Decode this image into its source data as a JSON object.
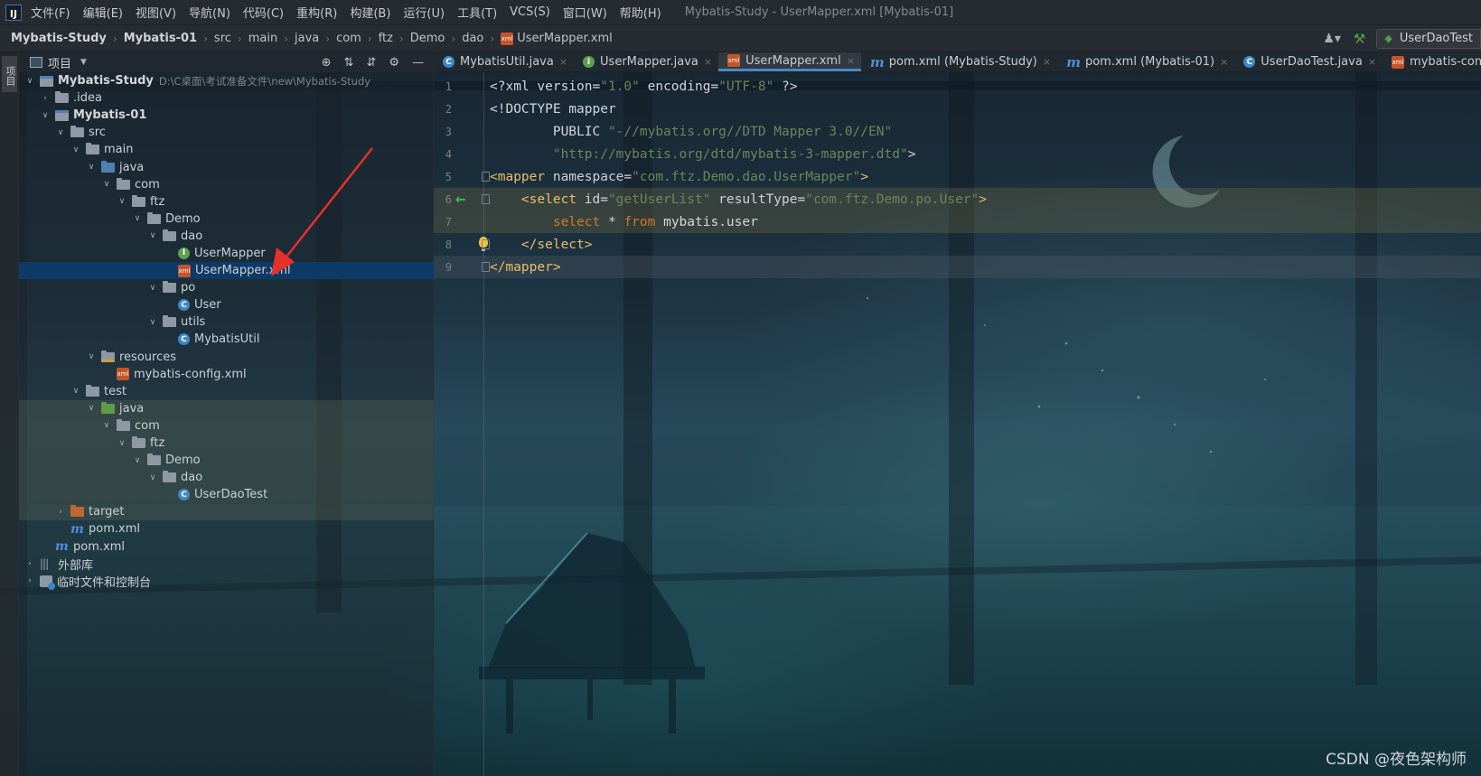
{
  "menubar": {
    "items": [
      "文件(F)",
      "编辑(E)",
      "视图(V)",
      "导航(N)",
      "代码(C)",
      "重构(R)",
      "构建(B)",
      "运行(U)",
      "工具(T)",
      "VCS(S)",
      "窗口(W)",
      "帮助(H)"
    ],
    "window_title": "Mybatis-Study - UserMapper.xml [Mybatis-01]"
  },
  "breadcrumb": {
    "items": [
      "Mybatis-Study",
      "Mybatis-01",
      "src",
      "main",
      "java",
      "com",
      "ftz",
      "Demo",
      "dao"
    ],
    "file": "UserMapper.xml"
  },
  "toolbar": {
    "run_config_label": "UserDaoTest"
  },
  "tool_strip": {
    "project_tab": "项目"
  },
  "project_panel": {
    "title": "项目",
    "tree": [
      {
        "label": "Mybatis-Study",
        "path": "D:\\C桌面\\考试准备文件\\new\\Mybatis-Study",
        "bold": true
      },
      {
        "label": ".idea"
      },
      {
        "label": "Mybatis-01",
        "bold": true
      },
      {
        "label": "src"
      },
      {
        "label": "main"
      },
      {
        "label": "java"
      },
      {
        "label": "com"
      },
      {
        "label": "ftz"
      },
      {
        "label": "Demo"
      },
      {
        "label": "dao"
      },
      {
        "label": "UserMapper"
      },
      {
        "label": "UserMapper.xml"
      },
      {
        "label": "po"
      },
      {
        "label": "User"
      },
      {
        "label": "utils"
      },
      {
        "label": "MybatisUtil"
      },
      {
        "label": "resources"
      },
      {
        "label": "mybatis-config.xml"
      },
      {
        "label": "test"
      },
      {
        "label": "java"
      },
      {
        "label": "com"
      },
      {
        "label": "ftz"
      },
      {
        "label": "Demo"
      },
      {
        "label": "dao"
      },
      {
        "label": "UserDaoTest"
      },
      {
        "label": "target"
      },
      {
        "label": "pom.xml"
      },
      {
        "label": "pom.xml"
      },
      {
        "label": "外部库"
      },
      {
        "label": "临时文件和控制台"
      }
    ]
  },
  "editor": {
    "tabs": [
      {
        "label": "MybatisUtil.java"
      },
      {
        "label": "UserMapper.java"
      },
      {
        "label": "UserMapper.xml"
      },
      {
        "label": "pom.xml (Mybatis-Study)"
      },
      {
        "label": "pom.xml (Mybatis-01)"
      },
      {
        "label": "UserDaoTest.java"
      },
      {
        "label": "mybatis-config.xml"
      }
    ],
    "active_tab": "UserMapper.xml",
    "lines": [
      {
        "no": "1",
        "tokens": [
          [
            "t-plain",
            "<?xml version="
          ],
          [
            "t-str",
            "\"1.0\""
          ],
          [
            "t-plain",
            " encoding="
          ],
          [
            "t-str",
            "\"UTF-8\""
          ],
          [
            "t-plain",
            " ?>"
          ]
        ]
      },
      {
        "no": "2",
        "tokens": [
          [
            "t-plain",
            "<!DOCTYPE mapper"
          ]
        ]
      },
      {
        "no": "3",
        "tokens": [
          [
            "t-plain",
            "        PUBLIC "
          ],
          [
            "t-str",
            "\"-//mybatis.org//DTD Mapper 3.0//EN\""
          ]
        ]
      },
      {
        "no": "4",
        "tokens": [
          [
            "t-plain",
            "        "
          ],
          [
            "t-str",
            "\"http://mybatis.org/dtd/mybatis-3-mapper.dtd\""
          ],
          [
            "t-plain",
            ">"
          ]
        ]
      },
      {
        "no": "5",
        "tokens": [
          [
            "t-tag",
            "<mapper"
          ],
          [
            "t-attr",
            " namespace="
          ],
          [
            "t-str",
            "\"com.ftz.Demo.dao.UserMapper\""
          ],
          [
            "t-tag",
            ">"
          ]
        ]
      },
      {
        "no": "6",
        "tokens": [
          [
            "t-tag",
            "    <select"
          ],
          [
            "t-attr",
            " id="
          ],
          [
            "t-str",
            "\"getUserList\""
          ],
          [
            "t-attr",
            " resultType="
          ],
          [
            "t-str",
            "\"com.ftz.Demo.po.User\""
          ],
          [
            "t-tag",
            ">"
          ]
        ]
      },
      {
        "no": "7",
        "tokens": [
          [
            "t-plain",
            "        "
          ],
          [
            "t-kw",
            "select"
          ],
          [
            "t-plain",
            " * "
          ],
          [
            "t-kw",
            "from"
          ],
          [
            "t-plain",
            " mybatis.user"
          ]
        ]
      },
      {
        "no": "8",
        "tokens": [
          [
            "t-tag",
            "    </select>"
          ]
        ]
      },
      {
        "no": "9",
        "tokens": [
          [
            "t-tag",
            "</mapper>"
          ]
        ]
      }
    ]
  },
  "watermark": "CSDN @夜色架构师",
  "colors": {
    "selection": "#0d3a66",
    "xml_tag": "#e8bf6a",
    "xml_string": "#6a8759",
    "sql_keyword": "#cc7832",
    "annotation_arrow": "#e8302a"
  }
}
